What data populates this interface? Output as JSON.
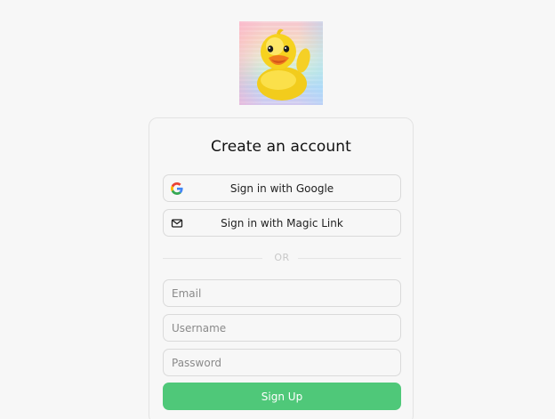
{
  "logo": {
    "icon": "rubber-duck-logo"
  },
  "signup": {
    "title": "Create an account",
    "google_button": {
      "label": "Sign in with Google",
      "icon": "google-icon"
    },
    "magic_link_button": {
      "label": "Sign in with Magic Link",
      "icon": "mail-icon"
    },
    "divider_text": "OR",
    "email": {
      "placeholder": "Email",
      "value": ""
    },
    "username": {
      "placeholder": "Username",
      "value": ""
    },
    "password": {
      "placeholder": "Password",
      "value": ""
    },
    "submit_label": "Sign Up"
  },
  "colors": {
    "page_bg": "#f7f7f7",
    "primary_button": "#4fc879",
    "border": "#dadada"
  }
}
